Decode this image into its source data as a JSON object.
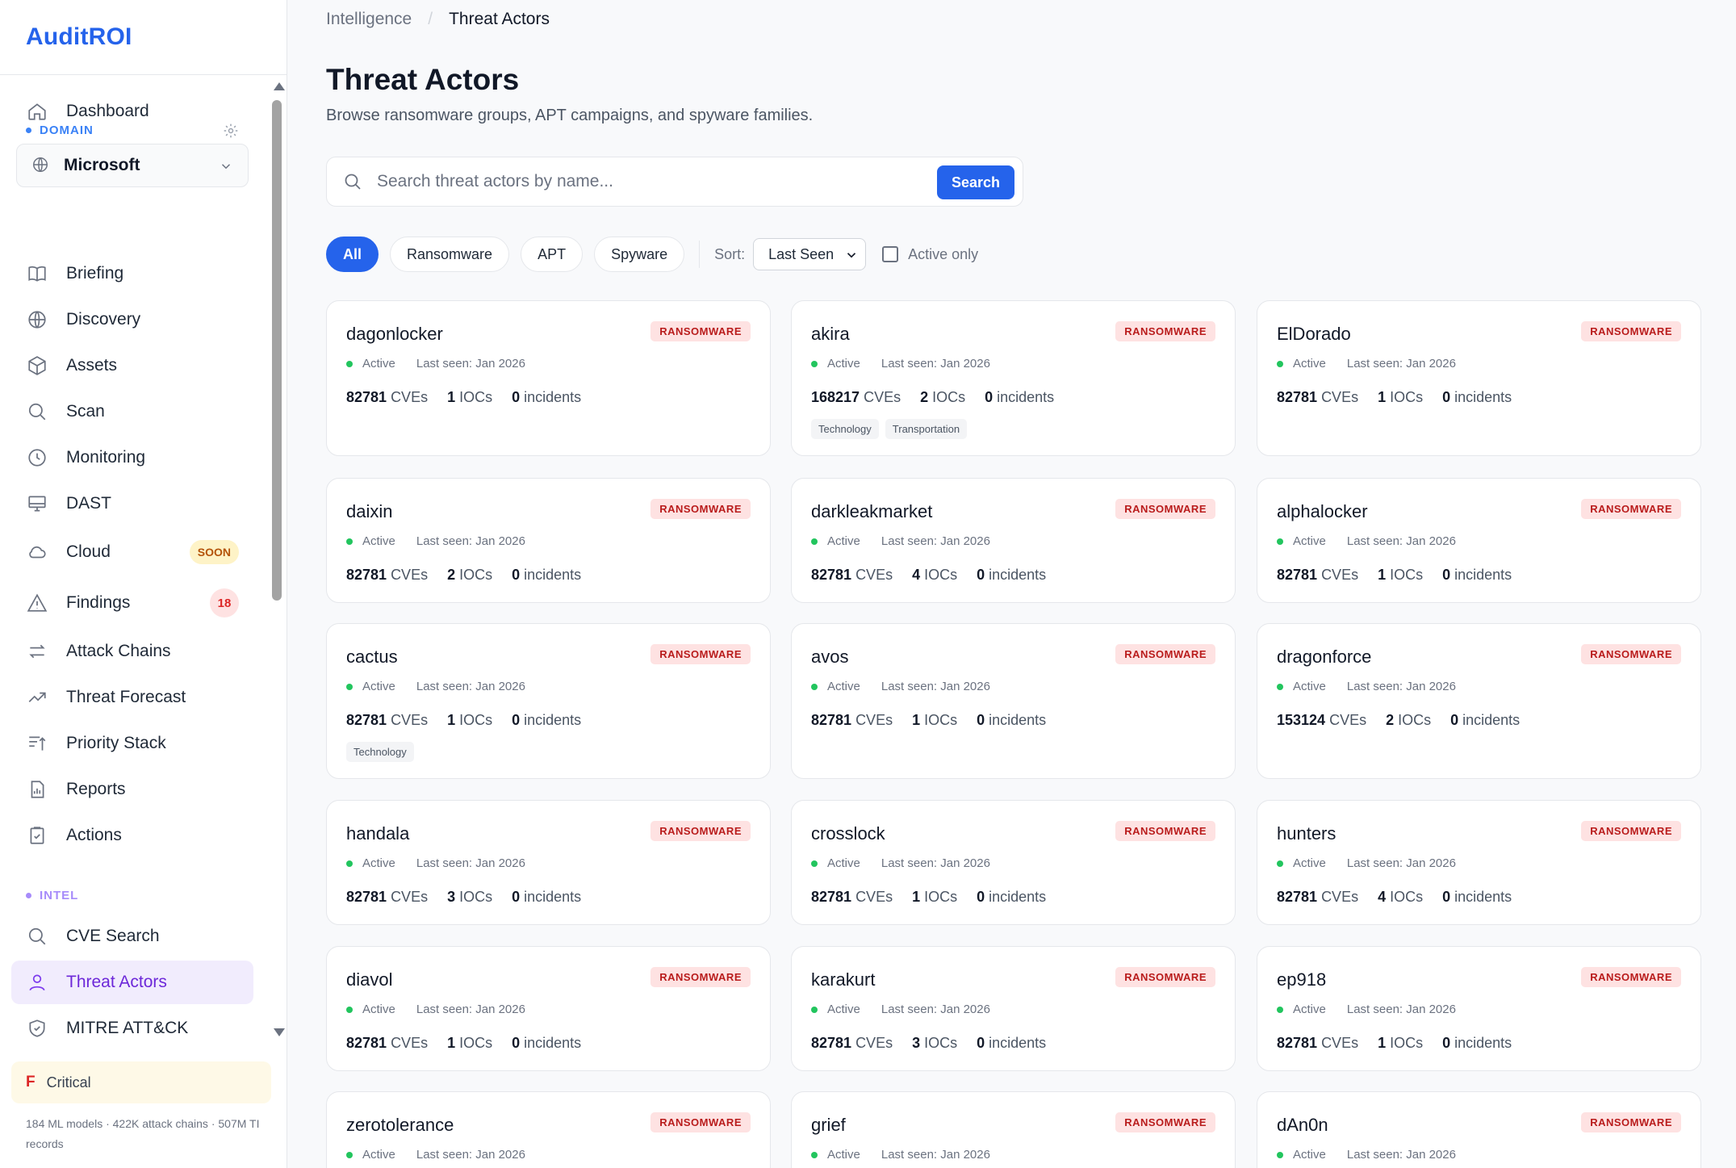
{
  "app": {
    "brand": "AuditROI"
  },
  "sidebar": {
    "dashboard": "Dashboard",
    "domain_section": "DOMAIN",
    "domain_value": "Microsoft",
    "items": [
      {
        "label": "Briefing"
      },
      {
        "label": "Discovery"
      },
      {
        "label": "Assets"
      },
      {
        "label": "Scan"
      },
      {
        "label": "Monitoring"
      },
      {
        "label": "DAST"
      },
      {
        "label": "Cloud",
        "badge": "SOON"
      },
      {
        "label": "Findings",
        "badge": "18"
      },
      {
        "label": "Attack Chains"
      },
      {
        "label": "Threat Forecast"
      },
      {
        "label": "Priority Stack"
      },
      {
        "label": "Reports"
      },
      {
        "label": "Actions"
      }
    ],
    "intel_section": "INTEL",
    "intel_items": [
      {
        "label": "CVE Search"
      },
      {
        "label": "Threat Actors"
      },
      {
        "label": "MITRE ATT&CK"
      }
    ],
    "risk": {
      "grade": "F",
      "label": "Critical"
    },
    "footer": "184 ML models · 422K attack chains · 507M TI records"
  },
  "breadcrumb": {
    "parent": "Intelligence",
    "separator": "/",
    "current": "Threat Actors"
  },
  "page": {
    "title": "Threat Actors",
    "subtitle": "Browse ransomware groups, APT campaigns, and spyware families."
  },
  "search": {
    "placeholder": "Search threat actors by name...",
    "value": "",
    "button": "Search"
  },
  "filters": {
    "pills": [
      "All",
      "Ransomware",
      "APT",
      "Spyware"
    ],
    "active_pill": "All",
    "sort_label": "Sort:",
    "sort_value": "Last Seen",
    "active_only_label": "Active only",
    "active_only_checked": false
  },
  "card_labels": {
    "cves": "CVEs",
    "iocs": "IOCs",
    "incidents": "incidents"
  },
  "actors": [
    {
      "name": "dagonlocker",
      "type": "RANSOMWARE",
      "status": "Active",
      "last_seen": "Last seen: Jan 2026",
      "cves": "82781",
      "iocs": "1",
      "incidents": "0",
      "tags": []
    },
    {
      "name": "akira",
      "type": "RANSOMWARE",
      "status": "Active",
      "last_seen": "Last seen: Jan 2026",
      "cves": "168217",
      "iocs": "2",
      "incidents": "0",
      "tags": [
        "Technology",
        "Transportation"
      ]
    },
    {
      "name": "ElDorado",
      "type": "RANSOMWARE",
      "status": "Active",
      "last_seen": "Last seen: Jan 2026",
      "cves": "82781",
      "iocs": "1",
      "incidents": "0",
      "tags": []
    },
    {
      "name": "daixin",
      "type": "RANSOMWARE",
      "status": "Active",
      "last_seen": "Last seen: Jan 2026",
      "cves": "82781",
      "iocs": "2",
      "incidents": "0",
      "tags": []
    },
    {
      "name": "darkleakmarket",
      "type": "RANSOMWARE",
      "status": "Active",
      "last_seen": "Last seen: Jan 2026",
      "cves": "82781",
      "iocs": "4",
      "incidents": "0",
      "tags": []
    },
    {
      "name": "alphalocker",
      "type": "RANSOMWARE",
      "status": "Active",
      "last_seen": "Last seen: Jan 2026",
      "cves": "82781",
      "iocs": "1",
      "incidents": "0",
      "tags": []
    },
    {
      "name": "cactus",
      "type": "RANSOMWARE",
      "status": "Active",
      "last_seen": "Last seen: Jan 2026",
      "cves": "82781",
      "iocs": "1",
      "incidents": "0",
      "tags": [
        "Technology"
      ]
    },
    {
      "name": "avos",
      "type": "RANSOMWARE",
      "status": "Active",
      "last_seen": "Last seen: Jan 2026",
      "cves": "82781",
      "iocs": "1",
      "incidents": "0",
      "tags": []
    },
    {
      "name": "dragonforce",
      "type": "RANSOMWARE",
      "status": "Active",
      "last_seen": "Last seen: Jan 2026",
      "cves": "153124",
      "iocs": "2",
      "incidents": "0",
      "tags": []
    },
    {
      "name": "handala",
      "type": "RANSOMWARE",
      "status": "Active",
      "last_seen": "Last seen: Jan 2026",
      "cves": "82781",
      "iocs": "3",
      "incidents": "0",
      "tags": []
    },
    {
      "name": "crosslock",
      "type": "RANSOMWARE",
      "status": "Active",
      "last_seen": "Last seen: Jan 2026",
      "cves": "82781",
      "iocs": "1",
      "incidents": "0",
      "tags": []
    },
    {
      "name": "hunters",
      "type": "RANSOMWARE",
      "status": "Active",
      "last_seen": "Last seen: Jan 2026",
      "cves": "82781",
      "iocs": "4",
      "incidents": "0",
      "tags": []
    },
    {
      "name": "diavol",
      "type": "RANSOMWARE",
      "status": "Active",
      "last_seen": "Last seen: Jan 2026",
      "cves": "82781",
      "iocs": "1",
      "incidents": "0",
      "tags": []
    },
    {
      "name": "karakurt",
      "type": "RANSOMWARE",
      "status": "Active",
      "last_seen": "Last seen: Jan 2026",
      "cves": "82781",
      "iocs": "3",
      "incidents": "0",
      "tags": []
    },
    {
      "name": "ep918",
      "type": "RANSOMWARE",
      "status": "Active",
      "last_seen": "Last seen: Jan 2026",
      "cves": "82781",
      "iocs": "1",
      "incidents": "0",
      "tags": []
    },
    {
      "name": "zerotolerance",
      "type": "RANSOMWARE",
      "status": "Active",
      "last_seen": "Last seen: Jan 2026",
      "cves": "",
      "iocs": "",
      "incidents": "",
      "tags": []
    },
    {
      "name": "grief",
      "type": "RANSOMWARE",
      "status": "Active",
      "last_seen": "Last seen: Jan 2026",
      "cves": "",
      "iocs": "",
      "incidents": "",
      "tags": []
    },
    {
      "name": "dAn0n",
      "type": "RANSOMWARE",
      "status": "Active",
      "last_seen": "Last seen: Jan 2026",
      "cves": "",
      "iocs": "",
      "incidents": "",
      "tags": []
    }
  ],
  "colors": {
    "accent": "#2563eb",
    "active_nav_bg": "#f1ecfd",
    "active_nav_text": "#6d28d9",
    "ransomware_badge_bg": "#fee2e2",
    "ransomware_badge_text": "#b91c1c",
    "status_active": "#22c55e",
    "domain_dot": "#3b82f6",
    "intel_dot": "#a78bfa"
  }
}
